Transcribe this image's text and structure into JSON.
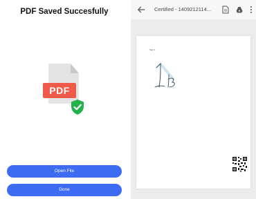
{
  "left": {
    "title": "PDF Saved Succesfully",
    "pdf_badge": "PDF",
    "buttons": {
      "open_file": "Open File",
      "done": "Done"
    },
    "icons": [
      "pdf-file-icon",
      "verified-shield-icon"
    ],
    "colors": {
      "pdf_red": "#f05a4a",
      "shield_green": "#22b14c",
      "button_blue": "#3d6bf2"
    }
  },
  "viewer": {
    "title": "Certified - 1409212114...",
    "icons": [
      "back-arrow-icon",
      "file-icon",
      "drive-icon",
      "more-vert-icon"
    ],
    "page_small_text": "Sign it"
  }
}
